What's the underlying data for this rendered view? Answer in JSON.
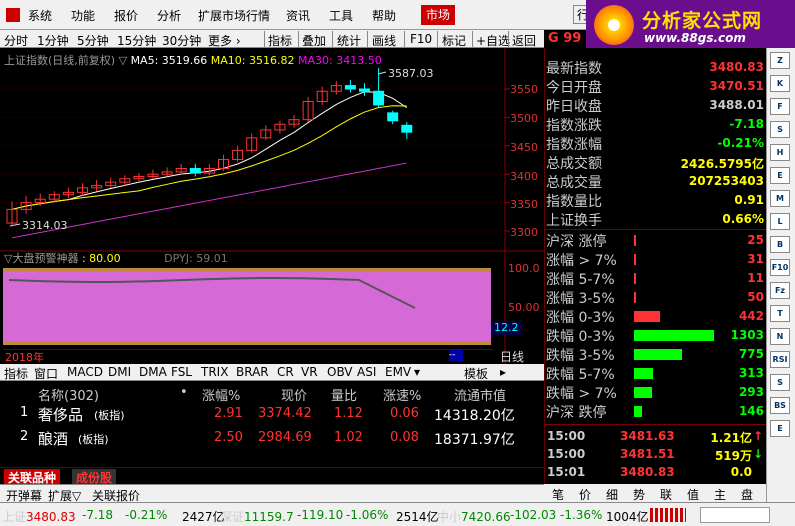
{
  "menu": [
    "系统",
    "功能",
    "报价",
    "分析",
    "扩展市场行情",
    "资讯",
    "工具",
    "帮助",
    "市场",
    "行"
  ],
  "logo": {
    "title": "分析家公式网",
    "url": "www.88gs.com"
  },
  "toolbar": {
    "left": [
      "分时",
      "1分钟",
      "5分钟",
      "15分钟",
      "30分钟",
      "更多 ›"
    ],
    "right": [
      "指标",
      "叠加",
      "统计",
      "画线",
      "F10",
      "标记",
      "+自选",
      "返回"
    ]
  },
  "g_code": "G 99",
  "chart": {
    "title": "上证指数(日线,前复权)",
    "ma_prefix": "▽",
    "ma5": "MA5: 3519.66",
    "ma10": "MA10: 3516.82",
    "ma30": "MA30: 3413.50",
    "high_label": "3587.03",
    "low_label": "3314.03",
    "y_ticks": [
      "3550",
      "3500",
      "3450",
      "3400",
      "3350",
      "3300"
    ],
    "colors": {
      "ma5": "#ffffff",
      "ma10": "#ffff00",
      "ma30": "#cc33cc",
      "up": "#ff3333",
      "down": "#00ffff"
    },
    "candles": [
      [
        3314,
        3338,
        3352,
        3310
      ],
      [
        3338,
        3350,
        3362,
        3330
      ],
      [
        3350,
        3356,
        3366,
        3344
      ],
      [
        3356,
        3364,
        3370,
        3350
      ],
      [
        3364,
        3368,
        3376,
        3358
      ],
      [
        3368,
        3376,
        3384,
        3362
      ],
      [
        3376,
        3380,
        3390,
        3370
      ],
      [
        3380,
        3386,
        3394,
        3376
      ],
      [
        3386,
        3392,
        3398,
        3380
      ],
      [
        3392,
        3396,
        3402,
        3388
      ],
      [
        3396,
        3400,
        3408,
        3392
      ],
      [
        3400,
        3404,
        3412,
        3396
      ],
      [
        3404,
        3410,
        3418,
        3400
      ],
      [
        3410,
        3402,
        3418,
        3396
      ],
      [
        3402,
        3410,
        3418,
        3398
      ],
      [
        3410,
        3426,
        3434,
        3406
      ],
      [
        3426,
        3442,
        3450,
        3422
      ],
      [
        3442,
        3464,
        3472,
        3438
      ],
      [
        3464,
        3478,
        3486,
        3460
      ],
      [
        3478,
        3488,
        3494,
        3472
      ],
      [
        3488,
        3496,
        3504,
        3482
      ],
      [
        3496,
        3528,
        3536,
        3492
      ],
      [
        3528,
        3546,
        3554,
        3522
      ],
      [
        3546,
        3556,
        3564,
        3540
      ],
      [
        3556,
        3550,
        3566,
        3544
      ],
      [
        3550,
        3546,
        3560,
        3538
      ],
      [
        3546,
        3522,
        3587,
        3518
      ],
      [
        3508,
        3494,
        3512,
        3488
      ],
      [
        3486,
        3474,
        3492,
        3462
      ]
    ]
  },
  "indicator": {
    "name": "▽大盘预警神器",
    "value": ": 80.00",
    "dpyj": "DPYJ: 59.01",
    "y_ticks": [
      "100.0",
      "50.00"
    ],
    "current": "12.2"
  },
  "year": "2018年",
  "rixian": "日线",
  "ind_tabs": [
    "指标",
    "窗口",
    "MACD",
    "DMI",
    "DMA",
    "FSL",
    "TRIX",
    "BRAR",
    "CR",
    "VR",
    "OBV",
    "ASI",
    "EMV",
    "▾",
    "模板",
    "▸"
  ],
  "list": {
    "headers": [
      "名称(302)",
      "•",
      "涨幅%",
      "现价",
      "量比",
      "涨速%",
      "流通市值"
    ],
    "rows": [
      {
        "idx": "1",
        "name": "奢侈品",
        "tag": "(板指)",
        "chg": "2.91",
        "price": "3374.42",
        "vr": "1.12",
        "speed": "0.06",
        "cap": "14318.20亿"
      },
      {
        "idx": "2",
        "name": "酿酒",
        "tag": "(板指)",
        "chg": "2.50",
        "price": "2984.69",
        "vr": "1.02",
        "speed": "0.08",
        "cap": "18371.97亿"
      }
    ]
  },
  "rel_tabs": [
    "关联品种",
    "成份股"
  ],
  "bottom_tabs": [
    "开弹幕",
    "扩展▽",
    "关联报价"
  ],
  "quote": [
    {
      "label": "最新指数",
      "value": "3480.83",
      "color": "#ff3333"
    },
    {
      "label": "今日开盘",
      "value": "3470.51",
      "color": "#ff3333"
    },
    {
      "label": "昨日收盘",
      "value": "3488.01",
      "color": "#cccccc"
    },
    {
      "label": "指数涨跌",
      "value": "-7.18",
      "color": "#00ff00"
    },
    {
      "label": "指数涨幅",
      "value": "-0.21%",
      "color": "#00ff00"
    },
    {
      "label": "总成交额",
      "value": "2426.5795亿",
      "color": "#ffff00"
    },
    {
      "label": "总成交量",
      "value": "207253403",
      "color": "#ffff00"
    },
    {
      "label": "指数量比",
      "value": "0.91",
      "color": "#ffff00"
    },
    {
      "label": "上证换手",
      "value": "0.66%",
      "color": "#ffff00"
    }
  ],
  "breadth": [
    {
      "label": "沪深 涨停",
      "value": "25",
      "color": "#ff3333",
      "bar": 0.0
    },
    {
      "label": "涨幅 > 7%",
      "value": "31",
      "color": "#ff3333",
      "bar": 0.0
    },
    {
      "label": "涨幅 5-7%",
      "value": "11",
      "color": "#ff3333",
      "bar": 0.0
    },
    {
      "label": "涨幅 3-5%",
      "value": "50",
      "color": "#ff3333",
      "bar": 0.02
    },
    {
      "label": "涨幅 0-3%",
      "value": "442",
      "color": "#ff3333",
      "bar": 0.33
    },
    {
      "label": "跌幅 0-3%",
      "value": "1303",
      "color": "#00ff00",
      "bar": 1.0
    },
    {
      "label": "跌幅 3-5%",
      "value": "775",
      "color": "#00ff00",
      "bar": 0.6
    },
    {
      "label": "跌幅 5-7%",
      "value": "313",
      "color": "#00ff00",
      "bar": 0.24
    },
    {
      "label": "跌幅 > 7%",
      "value": "293",
      "color": "#00ff00",
      "bar": 0.22
    },
    {
      "label": "沪深 跌停",
      "value": "146",
      "color": "#00ff00",
      "bar": 0.1
    }
  ],
  "ticks": [
    {
      "time": "15:00",
      "price": "3481.63",
      "vol": "1.21亿",
      "arrow": "↑",
      "vc": "#ffff00",
      "ac": "#ff3333"
    },
    {
      "time": "15:00",
      "price": "3481.51",
      "vol": "519万",
      "arrow": "↓",
      "vc": "#ffff00",
      "ac": "#00ff00"
    },
    {
      "time": "15:01",
      "price": "3480.83",
      "vol": "0.0",
      "arrow": "",
      "vc": "#ffff00",
      "ac": "#ff3333"
    }
  ],
  "right_tabs": [
    "笔",
    "价",
    "细",
    "势",
    "联",
    "值",
    "主",
    "盘"
  ],
  "icons": [
    "Z",
    "K",
    "F",
    "S",
    "H",
    "E",
    "M",
    "L",
    "B",
    "F10",
    "Fz",
    "T",
    "N",
    "RSI",
    "S",
    "BS",
    "E"
  ],
  "status": [
    {
      "label": "上证",
      "v": "3480.83",
      "c": "-7.18",
      "p": "-0.21%",
      "a": "2427亿"
    },
    {
      "label": "深证",
      "v": "11159.7",
      "c": "-119.10",
      "p": "-1.06%",
      "a": "2514亿"
    },
    {
      "label": "中小",
      "v": "7420.66",
      "c": "-102.03",
      "p": "-1.36%",
      "a": "1004亿"
    }
  ]
}
